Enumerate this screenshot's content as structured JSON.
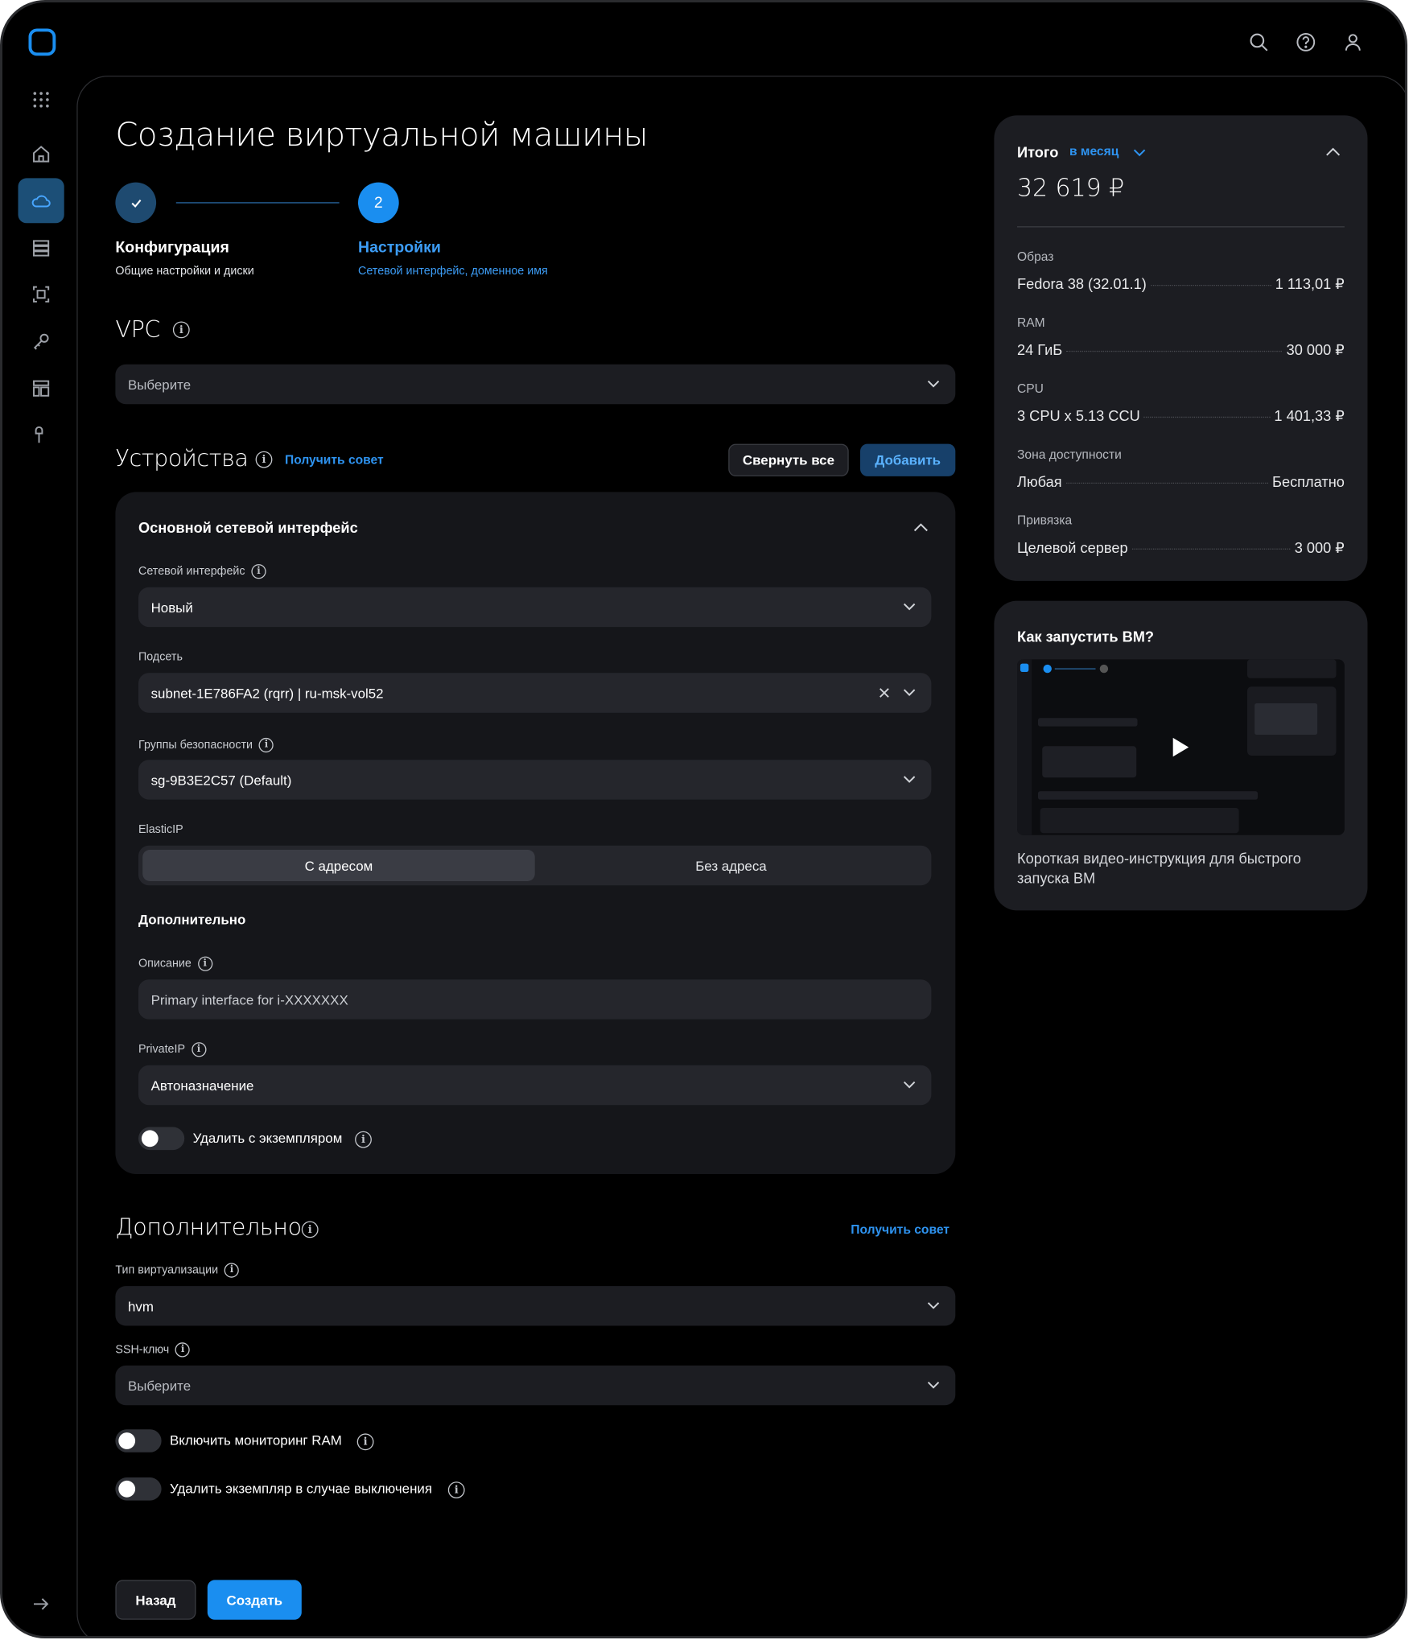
{
  "page": {
    "title": "Создание виртуальной машины"
  },
  "steps": [
    {
      "number": "",
      "title": "Конфигурация",
      "subtitle": "Общие настройки и диски",
      "state": "done"
    },
    {
      "number": "2",
      "title": "Настройки",
      "subtitle": "Сетевой интерфейс, доменное имя",
      "state": "active"
    }
  ],
  "vpc": {
    "title": "VPC",
    "placeholder": "Выберите"
  },
  "devices": {
    "title": "Устройства",
    "tip_link": "Получить совет",
    "collapse_button": "Свернуть все",
    "add_button": "Добавить",
    "interface_card": {
      "title": "Основной сетевой интерфейс",
      "network_interface": {
        "label": "Сетевой интерфейс",
        "value": "Новый"
      },
      "subnet": {
        "label": "Подсеть",
        "value": "subnet-1E786FA2 (rqrr) | ru-msk-vol52"
      },
      "security_groups": {
        "label": "Группы безопасности",
        "value": "sg-9B3E2C57 (Default)"
      },
      "elastic_ip": {
        "label": "ElasticIP",
        "options": [
          "С адресом",
          "Без адреса"
        ],
        "selected": "С адресом"
      },
      "additional_title": "Дополнительно",
      "description": {
        "label": "Описание",
        "value": "Primary interface for i-XXXXXXX"
      },
      "private_ip": {
        "label": "PrivateIP",
        "value": "Автоназначение"
      },
      "delete_with_instance": {
        "label": "Удалить с экземпляром",
        "on": false
      }
    }
  },
  "additional": {
    "title": "Дополнительно",
    "tip_link": "Получить совет",
    "virtualization": {
      "label": "Тип виртуализации",
      "value": "hvm"
    },
    "ssh_key": {
      "label": "SSH-ключ",
      "placeholder": "Выберите"
    },
    "ram_monitoring": {
      "label": "Включить мониторинг RAM",
      "on": false
    },
    "delete_on_shutdown": {
      "label": "Удалить экземпляр в случае выключения",
      "on": false
    }
  },
  "footer": {
    "back_button": "Назад",
    "create_button": "Создать"
  },
  "summary": {
    "title": "Итого",
    "period": "в месяц",
    "total": "32 619 ₽",
    "items": [
      {
        "label": "Образ",
        "name": "Fedora 38 (32.01.1)",
        "price": "1 113,01 ₽"
      },
      {
        "label": "RAM",
        "name": "24 ГиБ",
        "price": "30 000 ₽"
      },
      {
        "label": "CPU",
        "name": "3 CPU x 5.13 CCU",
        "price": "1 401,33 ₽"
      },
      {
        "label": "Зона доступности",
        "name": "Любая",
        "price": "Бесплатно"
      },
      {
        "label": "Привязка",
        "name": "Целевой сервер",
        "price": "3 000 ₽"
      }
    ]
  },
  "howto": {
    "title": "Как запустить ВМ?",
    "caption": "Короткая видео-инструкция для быстрого запуска ВМ"
  },
  "colors": {
    "accent": "#1a8ef0",
    "background": "#000000",
    "card": "#15161a",
    "field": "#1c1d22"
  },
  "icons": [
    "search-icon",
    "help-icon",
    "user-icon",
    "apps-grid-icon",
    "home-icon",
    "cloud-icon",
    "storage-icon",
    "frame-icon",
    "key-icon",
    "layout-icon",
    "tools-icon",
    "expand-arrow-icon"
  ]
}
